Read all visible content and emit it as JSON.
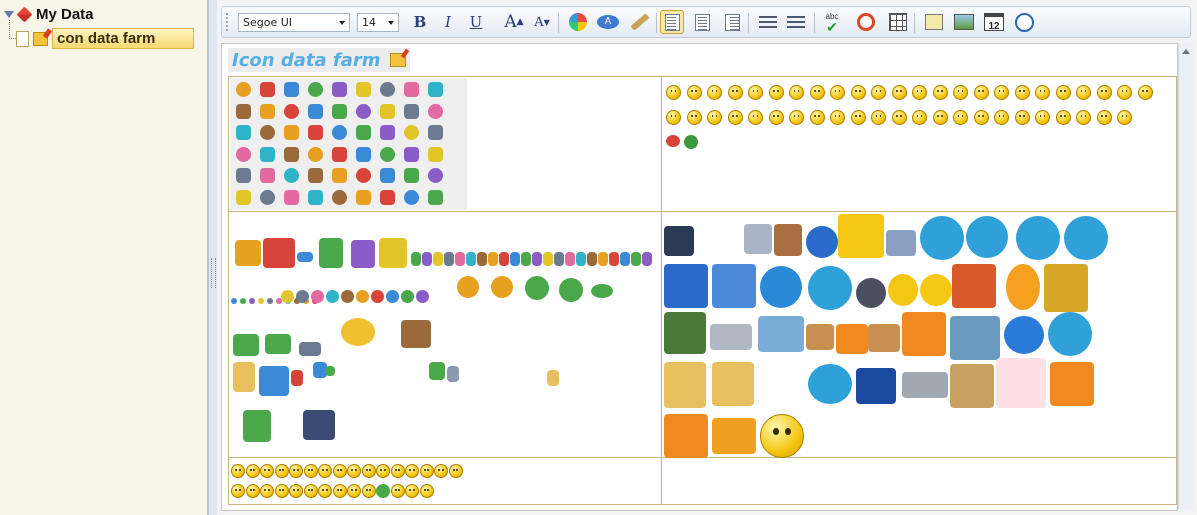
{
  "tree": {
    "root_label": "My Data",
    "child_label": "con data farm"
  },
  "toolbar": {
    "font_family": "Segoe UI",
    "font_size": "14",
    "bold": "B",
    "italic": "I",
    "underline": "U",
    "grow": "A",
    "shrink": "A",
    "buttons": [
      "bold-icon",
      "italic-icon",
      "underline-icon",
      "grow-font-icon",
      "shrink-font-icon",
      "font-color-icon",
      "highlight-icon",
      "format-painter-icon",
      "align-left-icon",
      "align-center-icon",
      "align-right-icon",
      "bullet-list-icon",
      "numbered-list-icon",
      "spell-check-icon",
      "alarm-icon",
      "insert-table-icon",
      "insert-note-icon",
      "insert-image-icon",
      "calendar-icon",
      "clock-icon"
    ],
    "calendar_day": "12",
    "spell_text": "abc"
  },
  "document": {
    "heading": "Icon data farm"
  },
  "colors": {
    "accent": "#55aee6",
    "table_border": "#c8b582",
    "tree_bg": "#f7f5e8",
    "selection": "#f7d970"
  }
}
